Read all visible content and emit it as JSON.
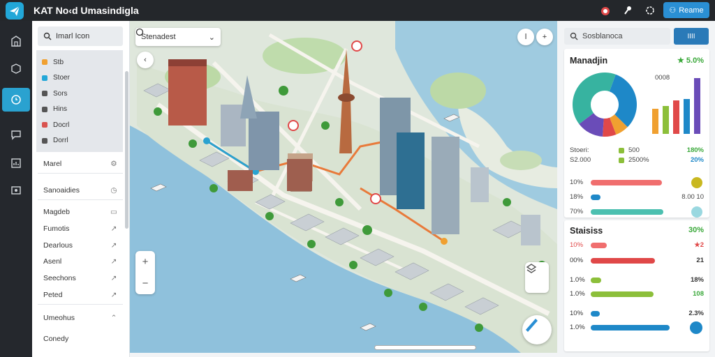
{
  "app": {
    "title": "KAT No‹d Umasindigla",
    "action_label": "Reame",
    "brand_color": "#22a7d8"
  },
  "rail": {
    "items": [
      "building-icon",
      "box-icon",
      "clock-icon",
      "chat-icon",
      "chart-icon",
      "image-icon"
    ],
    "active_index": 2
  },
  "left_panel": {
    "search_label": "Imarl Icon",
    "layers": [
      {
        "label": "Stb",
        "color": "#f0a030"
      },
      {
        "label": "Stoer",
        "color": "#22a7d8"
      },
      {
        "label": "Sors",
        "color": "#555555"
      },
      {
        "label": "Hins",
        "color": "#555555"
      },
      {
        "label": "Docrl",
        "color": "#d9534f"
      },
      {
        "label": "Dorrl",
        "color": "#555555"
      }
    ],
    "nav": [
      {
        "label": "Marel",
        "icon": "gear-icon"
      },
      {
        "label": "Sanoaidies",
        "icon": "clock-icon"
      },
      {
        "label": "Magdeb",
        "icon": "doc-icon"
      },
      {
        "label": "Fumotis",
        "icon": "share-icon"
      },
      {
        "label": "Dearlous",
        "icon": "share-icon"
      },
      {
        "label": "Asenl",
        "icon": "share-icon"
      },
      {
        "label": "Seechons",
        "icon": "share-icon"
      },
      {
        "label": "Peted",
        "icon": "share-icon"
      },
      {
        "label": "Umeohus",
        "icon": "chevron-up-icon"
      },
      {
        "label": "Conedy",
        "icon": ""
      }
    ]
  },
  "map": {
    "search_label": "Stenadest",
    "zoom_in": "+",
    "zoom_out": "−"
  },
  "right_panel": {
    "search_label": "Sosblanoca",
    "toggle_label": "IIII",
    "card1": {
      "title": "Manadjin",
      "head_value": "★ 5.0%",
      "head_color": "#3aa83a",
      "pie_label": "0008",
      "pie": [
        {
          "value": 28,
          "color": "#1e88c8"
        },
        {
          "value": 6,
          "color": "#f0a030"
        },
        {
          "value": 6,
          "color": "#e04848"
        },
        {
          "value": 12,
          "color": "#6a4cb8"
        },
        {
          "value": 36,
          "color": "#37b3a0"
        }
      ],
      "bars": [
        {
          "value": 36,
          "color": "#f0a030"
        },
        {
          "value": 40,
          "color": "#8cbf3a"
        },
        {
          "value": 48,
          "color": "#e04848"
        },
        {
          "value": 50,
          "color": "#1e88c8"
        },
        {
          "value": 80,
          "color": "#6a4cb8"
        }
      ],
      "stat_rows": [
        {
          "left": "Stoeri:",
          "mid": "500",
          "mid_color": "#8cbf3a",
          "right": "180%",
          "right_color": "#3aa83a"
        },
        {
          "left": "S2.000",
          "mid": "2500%",
          "mid_color": "#8cbf3a",
          "right": "20%",
          "right_color": "#1e88c8"
        }
      ],
      "progress": [
        {
          "label": "10%",
          "fill": 0.88,
          "color": "#f06e6e",
          "right": "",
          "dot": "#c9b820"
        },
        {
          "label": "18%",
          "fill": 0.12,
          "color": "#1e88c8",
          "right": "8.00 10",
          "dot": ""
        },
        {
          "label": "70%",
          "fill": 0.9,
          "color": "#4cc0b0",
          "right": "",
          "dot": "#9ad8e0"
        }
      ]
    },
    "card2": {
      "title": "Staisiss",
      "head_value": "30%",
      "head_color": "#3aa83a",
      "rows": [
        {
          "label": "10%",
          "label_color": "#e04848",
          "fill": 0.18,
          "color": "#f06e6e",
          "right": "★2",
          "right_color": "#e04848",
          "dot": ""
        },
        {
          "label": "00%",
          "label_color": "#333333",
          "fill": 0.72,
          "color": "#e04848",
          "right": "21",
          "right_color": "#333333",
          "dot": ""
        },
        {
          "label": "1.0%",
          "label_color": "#333333",
          "fill": 0.12,
          "color": "#8cbf3a",
          "right": "18%",
          "right_color": "#333333",
          "dot": ""
        },
        {
          "label": "1.0%",
          "label_color": "#333333",
          "fill": 0.7,
          "color": "#8cbf3a",
          "right": "108",
          "right_color": "#3aa83a",
          "dot": ""
        },
        {
          "label": "10%",
          "label_color": "#333333",
          "fill": 0.1,
          "color": "#1e88c8",
          "right": "2.3%",
          "right_color": "#333333",
          "dot": ""
        },
        {
          "label": "1.0%",
          "label_color": "#333333",
          "fill": 0.88,
          "color": "#1e88c8",
          "right": "",
          "right_color": "#333333",
          "dot": "#1e88c8"
        }
      ]
    }
  }
}
